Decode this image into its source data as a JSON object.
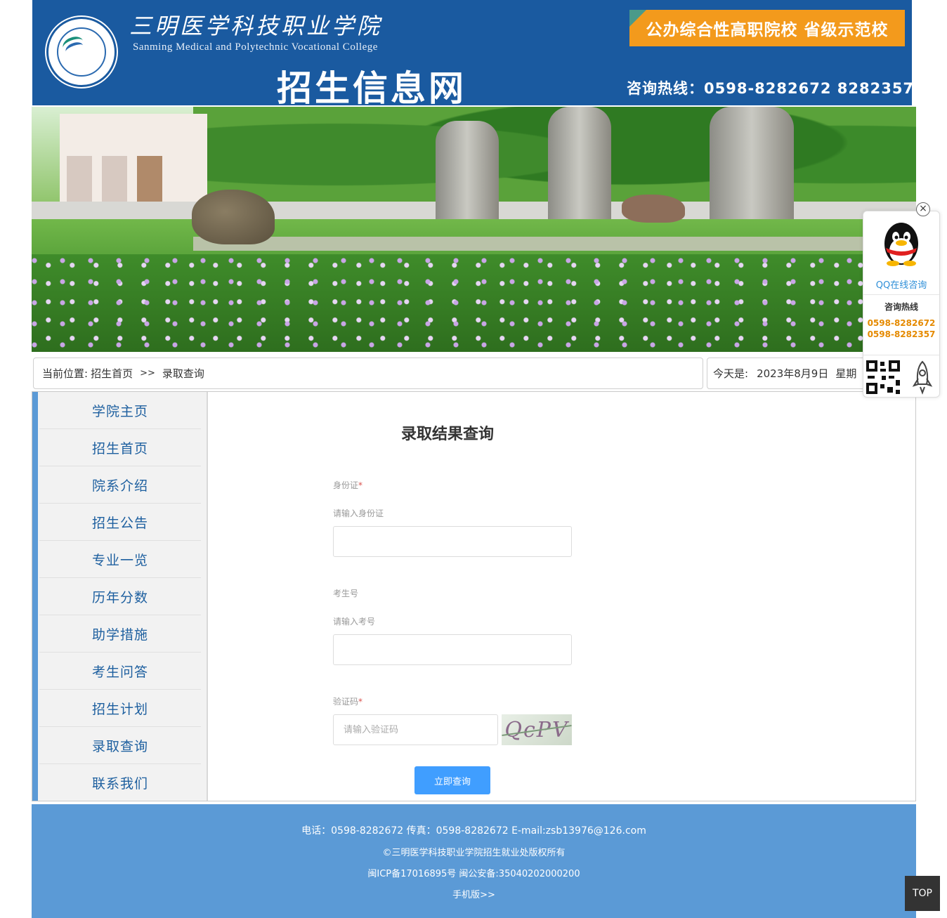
{
  "header": {
    "college_name_cn": "三明医学科技职业学院",
    "college_name_en": "Sanming Medical and Polytechnic Vocational College",
    "site_title": "招生信息网",
    "badge": "公办综合性高职院校 省级示范校",
    "hotline": "咨询热线：0598-8282672    8282357"
  },
  "breadcrumb": {
    "prefix": "当前位置:",
    "home": "招生首页",
    "separator": ">>",
    "current": "录取查询"
  },
  "today": {
    "label": "今天是:",
    "date": "2023年8月9日",
    "weekday": "星期"
  },
  "sidebar": {
    "items": [
      {
        "label": "学院主页"
      },
      {
        "label": "招生首页"
      },
      {
        "label": "院系介绍"
      },
      {
        "label": "招生公告"
      },
      {
        "label": "专业一览"
      },
      {
        "label": "历年分数"
      },
      {
        "label": "助学措施"
      },
      {
        "label": "考生问答"
      },
      {
        "label": "招生计划"
      },
      {
        "label": "录取查询"
      },
      {
        "label": "联系我们"
      }
    ]
  },
  "form": {
    "title": "录取结果查询",
    "id_card": {
      "label": "身份证",
      "required_mark": "*",
      "hint": "请输入身份证",
      "value": ""
    },
    "exam_no": {
      "label": "考生号",
      "hint": "请输入考号",
      "value": ""
    },
    "captcha": {
      "label": "验证码",
      "required_mark": "*",
      "placeholder": "请输入验证码",
      "image_text": "QcPV"
    },
    "submit_label": "立即查询"
  },
  "footer": {
    "contact": "电话：0598-8282672 传真：0598-8282672 E-mail:zsb13976@126.com",
    "copyright": "©三明医学科技职业学院招生就业处版权所有",
    "icp": "闽ICP备17016895号  闽公安备:35040202000200",
    "mobile_link": "手机版>>"
  },
  "float_widget": {
    "close": "×",
    "qq_label": "QQ在线咨询",
    "hotline_title": "咨询热线",
    "phones": [
      "0598-8282672",
      "0598-8282357"
    ]
  },
  "top_button": "TOP",
  "colors": {
    "header_bg": "#1a5aa0",
    "badge_bg": "#f39a1c",
    "sidebar_accent": "#5b9ad6",
    "nav_text": "#1d5f9f",
    "submit_bg": "#409eff",
    "footer_bg": "#5b9ad6",
    "phone_orange": "#e58a00"
  }
}
